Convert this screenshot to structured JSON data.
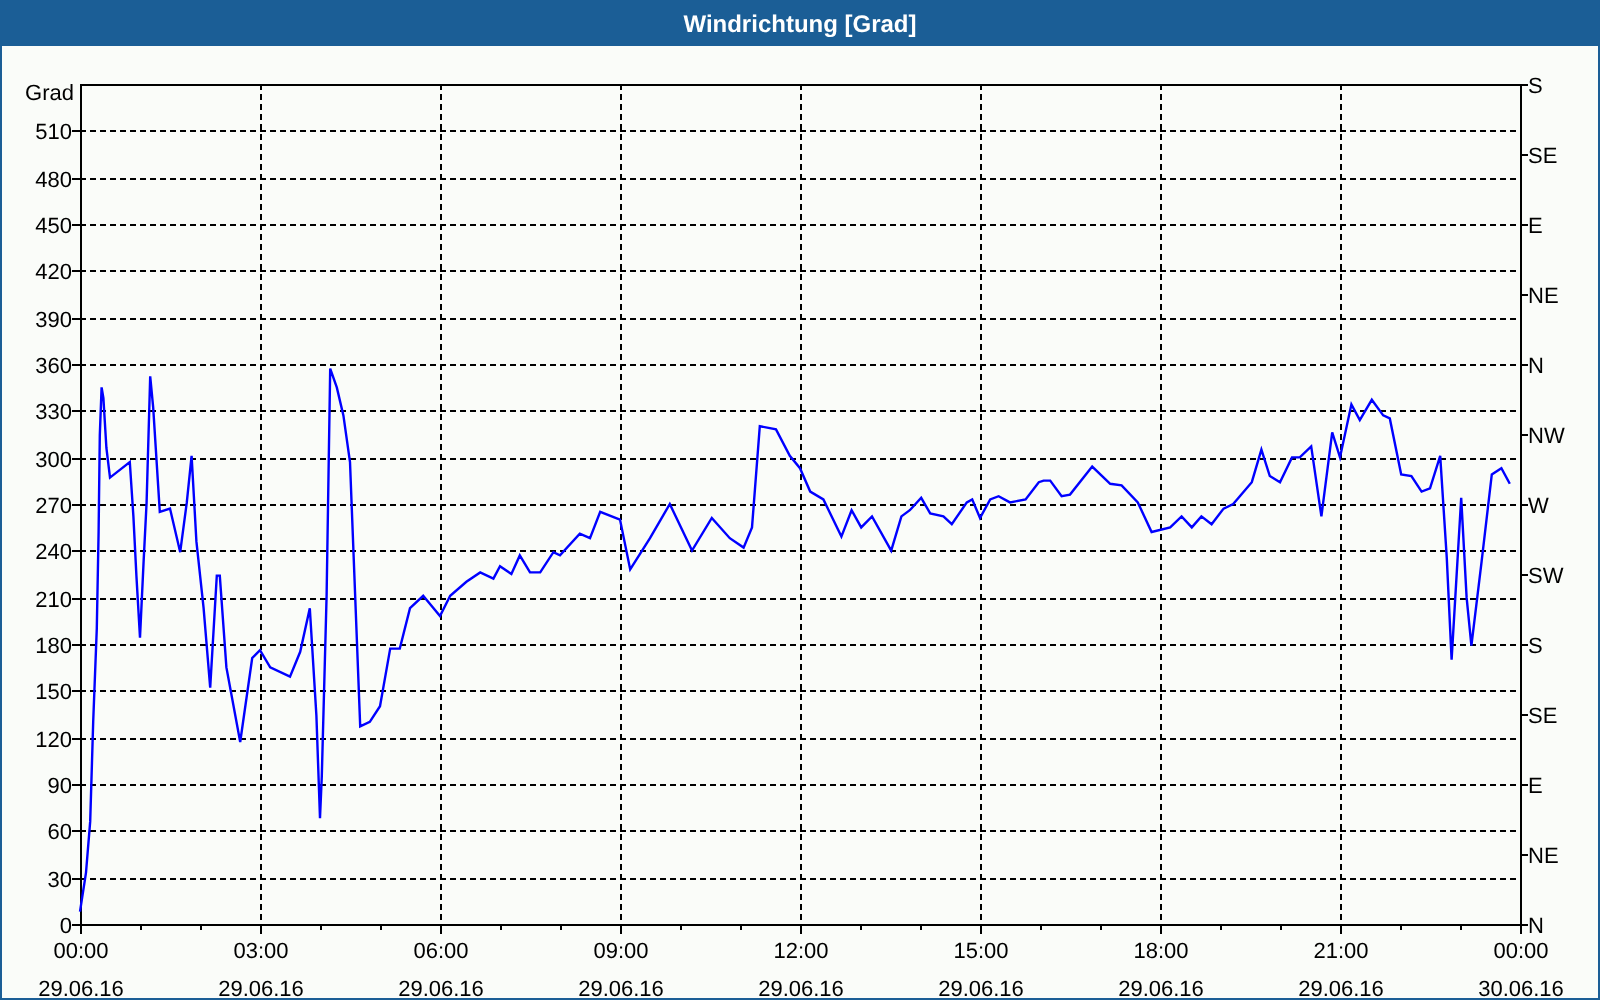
{
  "window": {
    "title": "Windrichtung [Grad]"
  },
  "chart": {
    "chart_data": {
      "type": "line",
      "grid": true,
      "ylabel": "Grad",
      "xlim": [
        0,
        24
      ],
      "ylim": [
        0,
        540
      ],
      "xticks": [
        {
          "value": 0,
          "label": "00:00"
        },
        {
          "value": 3,
          "label": "03:00"
        },
        {
          "value": 6,
          "label": "06:00"
        },
        {
          "value": 9,
          "label": "09:00"
        },
        {
          "value": 12,
          "label": "12:00"
        },
        {
          "value": 15,
          "label": "15:00"
        },
        {
          "value": 18,
          "label": "18:00"
        },
        {
          "value": 21,
          "label": "21:00"
        },
        {
          "value": 24,
          "label": "00:00"
        }
      ],
      "yticks": [
        0,
        30,
        60,
        90,
        120,
        150,
        180,
        210,
        240,
        270,
        300,
        330,
        360,
        390,
        420,
        450,
        480,
        510
      ],
      "x": [
        0,
        0.1,
        0.17,
        0.22,
        0.28,
        0.31,
        0.33,
        0.36,
        0.39,
        0.44,
        0.5,
        0.83,
        0.89,
        0.94,
        1.0,
        1.06,
        1.11,
        1.17,
        1.22,
        1.33,
        1.5,
        1.67,
        1.78,
        1.86,
        1.94,
        2.06,
        2.17,
        2.28,
        2.33,
        2.44,
        2.67,
        2.87,
        3.0,
        3.17,
        3.5,
        3.67,
        3.83,
        3.94,
        4.0,
        4.03,
        4.11,
        4.17,
        4.28,
        4.39,
        4.5,
        4.67,
        4.83,
        5.0,
        5.17,
        5.33,
        5.5,
        5.72,
        6.0,
        6.17,
        6.44,
        6.67,
        6.89,
        7.0,
        7.19,
        7.33,
        7.5,
        7.67,
        7.89,
        8.0,
        8.33,
        8.5,
        8.67,
        9.0,
        9.17,
        9.5,
        9.83,
        10.2,
        10.53,
        10.83,
        11.06,
        11.2,
        11.33,
        11.6,
        11.83,
        12.0,
        12.17,
        12.39,
        12.69,
        12.86,
        13.02,
        13.2,
        13.52,
        13.69,
        13.83,
        14.02,
        14.17,
        14.39,
        14.53,
        14.78,
        14.87,
        15.0,
        15.17,
        15.31,
        15.5,
        15.76,
        15.98,
        16.06,
        16.17,
        16.36,
        16.5,
        16.87,
        17.17,
        17.36,
        17.63,
        17.86,
        18.17,
        18.36,
        18.53,
        18.69,
        18.86,
        19.06,
        19.22,
        19.53,
        19.69,
        19.83,
        20.0,
        20.2,
        20.33,
        20.52,
        20.69,
        20.87,
        21.0,
        21.19,
        21.33,
        21.53,
        21.72,
        21.83,
        22.02,
        22.19,
        22.36,
        22.5,
        22.67,
        22.78,
        22.86,
        23.02,
        23.11,
        23.19,
        23.36,
        23.53,
        23.69,
        23.83
      ],
      "series": [
        {
          "color": "#0000ff",
          "values": [
            8,
            33,
            66,
            130,
            190,
            252,
            314,
            345,
            338,
            306,
            287,
            297,
            262,
            224,
            184,
            233,
            271,
            352,
            332,
            265,
            267,
            239,
            271,
            301,
            246,
            203,
            152,
            224,
            224,
            165,
            117,
            171,
            176,
            165,
            159,
            175,
            203,
            134,
            68,
            95,
            211,
            357,
            345,
            327,
            297,
            127,
            130,
            140,
            177,
            177,
            203,
            211,
            198,
            211,
            220,
            226,
            222,
            230,
            225,
            237,
            226,
            226,
            239,
            237,
            251,
            248,
            265,
            260,
            228,
            248,
            270,
            240,
            261,
            248,
            242,
            255,
            320,
            318,
            301,
            293,
            278,
            273,
            249,
            266,
            255,
            262,
            240,
            262,
            266,
            274,
            264,
            262,
            257,
            271,
            273,
            261,
            273,
            275,
            271,
            273,
            284,
            285,
            285,
            275,
            276,
            294,
            283,
            282,
            271,
            252,
            255,
            262,
            255,
            262,
            257,
            267,
            270,
            284,
            305,
            288,
            284,
            300,
            300,
            307,
            262,
            316,
            300,
            334,
            324,
            337,
            327,
            325,
            289,
            288,
            278,
            280,
            301,
            235,
            170,
            274,
            210,
            179,
            233,
            289,
            293,
            283
          ]
        }
      ]
    },
    "compass_labels": [
      "S",
      "SE",
      "E",
      "NE",
      "N",
      "NW",
      "W",
      "SW",
      "S",
      "SE",
      "E",
      "NE",
      "N"
    ],
    "date_labels": [
      "29.06.16",
      "29.06.16",
      "29.06.16",
      "29.06.16",
      "29.06.16",
      "29.06.16",
      "29.06.16",
      "29.06.16",
      "30.06.16"
    ]
  }
}
